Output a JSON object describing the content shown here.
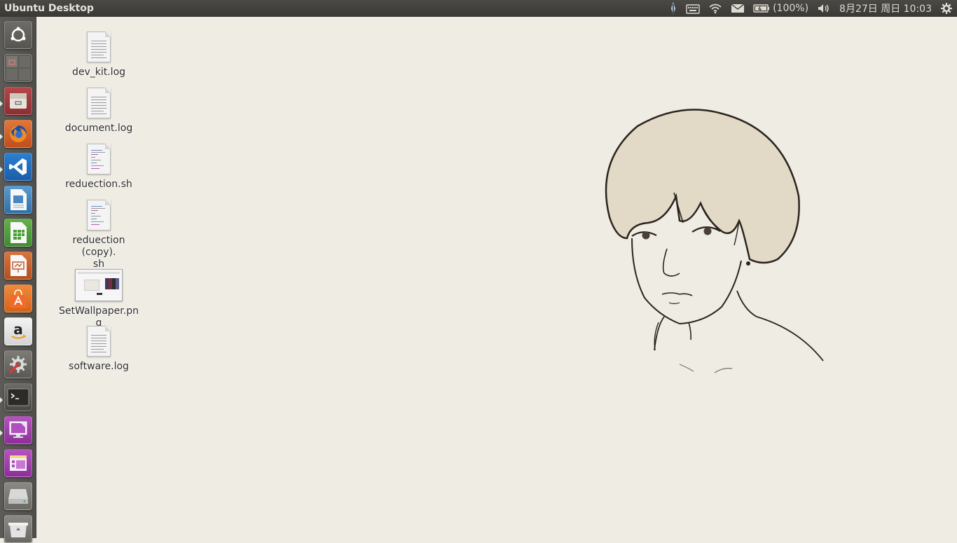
{
  "topbar": {
    "title": "Ubuntu Desktop",
    "battery": "(100%)",
    "clock": "8月27日 周日 10:03"
  },
  "launcher": {
    "items": [
      {
        "name": "dash-home",
        "icon": "ubuntu-logo-icon"
      },
      {
        "name": "workspace-switcher",
        "icon": "workspaces-icon"
      },
      {
        "name": "files",
        "icon": "file-cabinet-icon"
      },
      {
        "name": "firefox",
        "icon": "firefox-icon"
      },
      {
        "name": "vscode",
        "icon": "vscode-icon"
      },
      {
        "name": "libreoffice-writer",
        "icon": "writer-icon"
      },
      {
        "name": "libreoffice-calc",
        "icon": "calc-icon"
      },
      {
        "name": "libreoffice-impress",
        "icon": "impress-icon"
      },
      {
        "name": "software-center",
        "icon": "shopping-bag-icon"
      },
      {
        "name": "amazon",
        "icon": "amazon-icon"
      },
      {
        "name": "system-settings",
        "icon": "wrench-gear-icon"
      },
      {
        "name": "terminal",
        "icon": "terminal-icon"
      },
      {
        "name": "remote-desktop",
        "icon": "monitor-icon"
      },
      {
        "name": "app-window",
        "icon": "window-icon"
      },
      {
        "name": "drive",
        "icon": "drive-icon"
      },
      {
        "name": "trash",
        "icon": "trash-icon"
      }
    ]
  },
  "desktop": {
    "files": [
      {
        "label": "dev_kit.log",
        "type": "text"
      },
      {
        "label": "document.log",
        "type": "text"
      },
      {
        "label": "reduection.sh",
        "type": "script"
      },
      {
        "label": "reduection (copy).\nsh",
        "type": "script"
      },
      {
        "label": "SetWallpaper.png",
        "type": "image"
      },
      {
        "label": "software.log",
        "type": "text"
      }
    ]
  },
  "colors": {
    "panel": "#3c3b37",
    "launcher": "#57564f",
    "wallpaper": "#efece4"
  }
}
